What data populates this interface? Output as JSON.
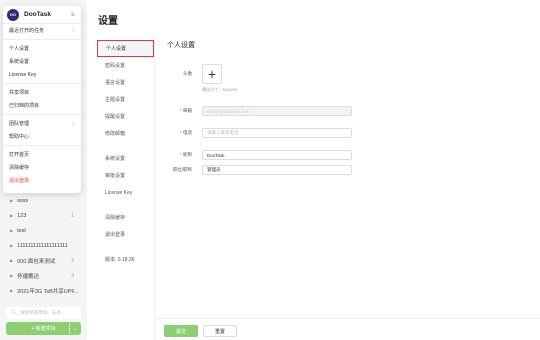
{
  "app": {
    "name": "DooTask",
    "avatar_text": "DO"
  },
  "menu": {
    "recent_tasks": "最近打开的任务",
    "items_a": [
      "个人设置",
      "系统设置",
      "License Key"
    ],
    "items_b": [
      "共享项目",
      "已归档的项目"
    ],
    "team": "团队管理",
    "help": "帮助中心",
    "items_c": [
      "打开首页",
      "清除缓存"
    ],
    "logout": "退出登录"
  },
  "projects": [
    {
      "name": "ssss",
      "count": ""
    },
    {
      "name": "123",
      "count": "1"
    },
    {
      "name": "test",
      "count": ""
    },
    {
      "name": "1111111111111111111",
      "count": ""
    },
    {
      "name": "000.面包来测试",
      "count": "3"
    },
    {
      "name": "怀疆戴达",
      "count": "3"
    },
    {
      "name": "2021年3G TsB共享UPF...",
      "count": ""
    }
  ],
  "sidebar": {
    "search_placeholder": "搜索所有项目、任务...",
    "new_project": "+ 新建项目"
  },
  "page": {
    "title": "设置"
  },
  "settings_nav": {
    "group1": [
      "个人设置",
      "密码设置",
      "语言设置",
      "主题设置",
      "提醒设置",
      "修改邮箱"
    ],
    "group2": [
      "系统设置",
      "审批设置",
      "License Key"
    ],
    "group3": [
      "清除缓存",
      "退出登录"
    ],
    "version": "版本: 0.18.36"
  },
  "form": {
    "title": "个人设置",
    "avatar_label": "头像",
    "avatar_hint": "建议尺寸：200x200",
    "email_label": "邮箱",
    "email_value": "admin@dootask.com",
    "phone_label": "电话",
    "phone_placeholder": "请输入联系电话",
    "nickname_label": "昵称",
    "nickname_value": "DooTask",
    "position_label": "职位/职称",
    "position_value": "管理员",
    "submit": "提交",
    "reset": "重置"
  },
  "colors": {
    "accent": "#8bcf70",
    "danger": "#f0463c",
    "avatar_bg": "#2d2b7a",
    "highlight": "#e53935"
  }
}
